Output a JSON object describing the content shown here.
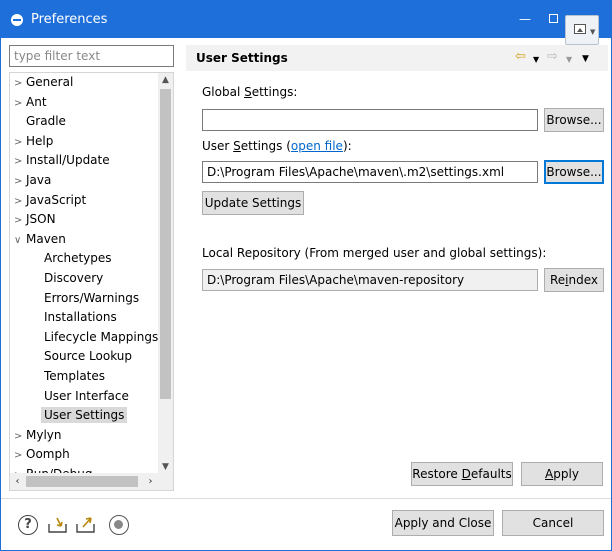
{
  "window": {
    "title": "Preferences",
    "min_glyph": "—",
    "close_glyph": "✕"
  },
  "sidebar": {
    "filter_placeholder": "type filter text",
    "items": [
      {
        "label": "General",
        "arrow": ">"
      },
      {
        "label": "Ant",
        "arrow": ">"
      },
      {
        "label": "Gradle",
        "arrow": ""
      },
      {
        "label": "Help",
        "arrow": ">"
      },
      {
        "label": "Install/Update",
        "arrow": ">"
      },
      {
        "label": "Java",
        "arrow": ">"
      },
      {
        "label": "JavaScript",
        "arrow": ">"
      },
      {
        "label": "JSON",
        "arrow": ">"
      },
      {
        "label": "Maven",
        "arrow": "∨"
      },
      {
        "label": "Archetypes",
        "arrow": ""
      },
      {
        "label": "Discovery",
        "arrow": ""
      },
      {
        "label": "Errors/Warnings",
        "arrow": ""
      },
      {
        "label": "Installations",
        "arrow": ""
      },
      {
        "label": "Lifecycle Mappings",
        "arrow": ""
      },
      {
        "label": "Source Lookup",
        "arrow": ""
      },
      {
        "label": "Templates",
        "arrow": ""
      },
      {
        "label": "User Interface",
        "arrow": ""
      },
      {
        "label": "User Settings",
        "arrow": "",
        "selected": true
      },
      {
        "label": "Mylyn",
        "arrow": ">"
      },
      {
        "label": "Oomph",
        "arrow": ">"
      },
      {
        "label": "Run/Debug",
        "arrow": ">"
      }
    ]
  },
  "page": {
    "title": "User Settings",
    "global_label_pre": "Global ",
    "global_label_mn": "S",
    "global_label_post": "ettings:",
    "global_value": "",
    "browse_label": "Browse...",
    "user_label_pre": "User ",
    "user_label_mn": "S",
    "user_label_post": "ettings (",
    "open_file_link": "open file",
    "user_label_end": "):",
    "user_value": "D:\\Program Files\\Apache\\maven\\.m2\\settings.xml",
    "update_settings_label": "Update Settings",
    "local_repo_label": "Local Repository (From merged user and global settings):",
    "local_repo_value": "D:\\Program Files\\Apache\\maven-repository",
    "reindex_pre": "Re",
    "reindex_mn": "i",
    "reindex_post": "ndex",
    "restore_pre": "Restore ",
    "restore_mn": "D",
    "restore_post": "efaults",
    "apply_mn": "A",
    "apply_post": "pply"
  },
  "footer": {
    "apply_close_label": "Apply and Close",
    "cancel_label": "Cancel",
    "help_glyph": "?"
  },
  "icons": {
    "back": "arrow-left-icon",
    "forward": "arrow-right-icon",
    "help": "help-icon",
    "import": "import-icon",
    "export": "export-icon",
    "oomph": "oomph-icon"
  }
}
